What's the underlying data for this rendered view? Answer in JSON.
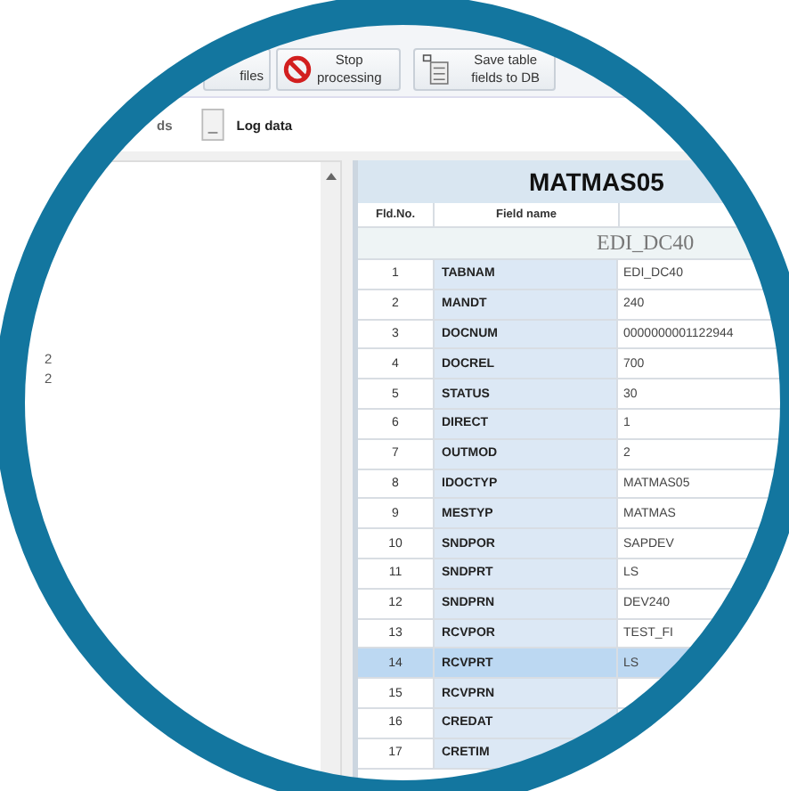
{
  "toolbar": {
    "buttons": [
      {
        "kind": "files",
        "label": "files"
      },
      {
        "kind": "stop",
        "label": "Stop\nprocessing"
      },
      {
        "kind": "save",
        "label": "Save table\nfields to DB"
      }
    ]
  },
  "tabs": [
    {
      "label": "ds",
      "selected": false,
      "icon": false
    },
    {
      "label": "Log data",
      "selected": true,
      "icon": true
    }
  ],
  "left_panel": {
    "items": [
      "2",
      "2"
    ]
  },
  "table": {
    "title": "MATMAS05",
    "columns": [
      "Fld.No.",
      "Field name"
    ],
    "segment": "EDI_DC40",
    "rows": [
      {
        "no": "1",
        "name": "TABNAM",
        "value": "EDI_DC40",
        "selected": false
      },
      {
        "no": "2",
        "name": "MANDT",
        "value": "240",
        "selected": false
      },
      {
        "no": "3",
        "name": "DOCNUM",
        "value": "0000000001122944",
        "selected": false
      },
      {
        "no": "4",
        "name": "DOCREL",
        "value": "700",
        "selected": false
      },
      {
        "no": "5",
        "name": "STATUS",
        "value": "30",
        "selected": false
      },
      {
        "no": "6",
        "name": "DIRECT",
        "value": "1",
        "selected": false
      },
      {
        "no": "7",
        "name": "OUTMOD",
        "value": "2",
        "selected": false
      },
      {
        "no": "8",
        "name": "IDOCTYP",
        "value": "MATMAS05",
        "selected": false
      },
      {
        "no": "9",
        "name": "MESTYP",
        "value": "MATMAS",
        "selected": false
      },
      {
        "no": "10",
        "name": "SNDPOR",
        "value": "SAPDEV",
        "selected": false
      },
      {
        "no": "11",
        "name": "SNDPRT",
        "value": "LS",
        "selected": false
      },
      {
        "no": "12",
        "name": "SNDPRN",
        "value": "DEV240",
        "selected": false
      },
      {
        "no": "13",
        "name": "RCVPOR",
        "value": "TEST_FI",
        "selected": false
      },
      {
        "no": "14",
        "name": "RCVPRT",
        "value": "LS",
        "selected": true
      },
      {
        "no": "15",
        "name": "RCVPRN",
        "selected": false
      },
      {
        "no": "16",
        "name": "CREDAT",
        "selected": false
      },
      {
        "no": "17",
        "name": "CRETIM",
        "selected": false
      }
    ]
  }
}
